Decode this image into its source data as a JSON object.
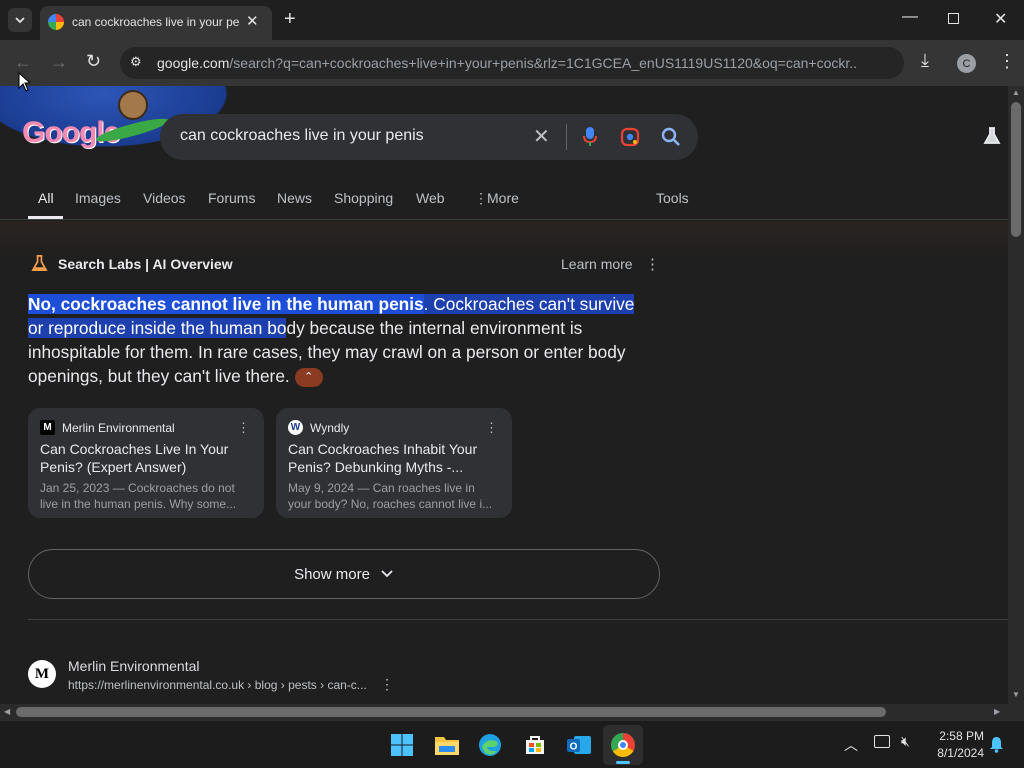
{
  "browser": {
    "tab_title": "can cockroaches live in your pe",
    "url_domain": "google.com",
    "url_path": "/search?q=can+cockroaches+live+in+your+penis&rlz=1C1GCEA_enUS1119US1120&oq=can+cockr...",
    "profile_initial": "C"
  },
  "search": {
    "query": "can cockroaches live in your penis",
    "logo_text": "Google"
  },
  "nav_tabs": [
    "All",
    "Images",
    "Videos",
    "Forums",
    "News",
    "Shopping",
    "Web",
    "More",
    "Tools"
  ],
  "ai_overview": {
    "header": "Search Labs | AI Overview",
    "learn_more": "Learn more",
    "hl_bold": "No, cockroaches cannot live in the human penis",
    "hl_rest": ". Cockroaches can't survive",
    "hl_line2": "or reproduce inside the human ",
    "hl_line2b": "bo",
    "plain": "dy because the internal environment is inhospitable for them. In rare cases, they may crawl on a person or enter body openings, but they can't live there."
  },
  "cards": [
    {
      "site": "Merlin Environmental",
      "fav": "M",
      "title": "Can Cockroaches Live In Your Penis? (Expert Answer)",
      "snippet": "Jan 25, 2023 — Cockroaches do not live in the human penis. Why some..."
    },
    {
      "site": "Wyndly",
      "fav": "W",
      "title": "Can Cockroaches Inhabit Your Penis? Debunking Myths -...",
      "snippet": "May 9, 2024 — Can roaches live in your body? No, roaches cannot live i..."
    }
  ],
  "show_more": "Show more",
  "result": {
    "site": "Merlin Environmental",
    "url": "https://merlinenvironmental.co.uk › blog › pests › can-c..."
  },
  "taskbar": {
    "time": "2:58 PM",
    "date": "8/1/2024"
  },
  "colors": {
    "highlight": "#1d4ed8",
    "link_blue": "#8ab4f8"
  }
}
